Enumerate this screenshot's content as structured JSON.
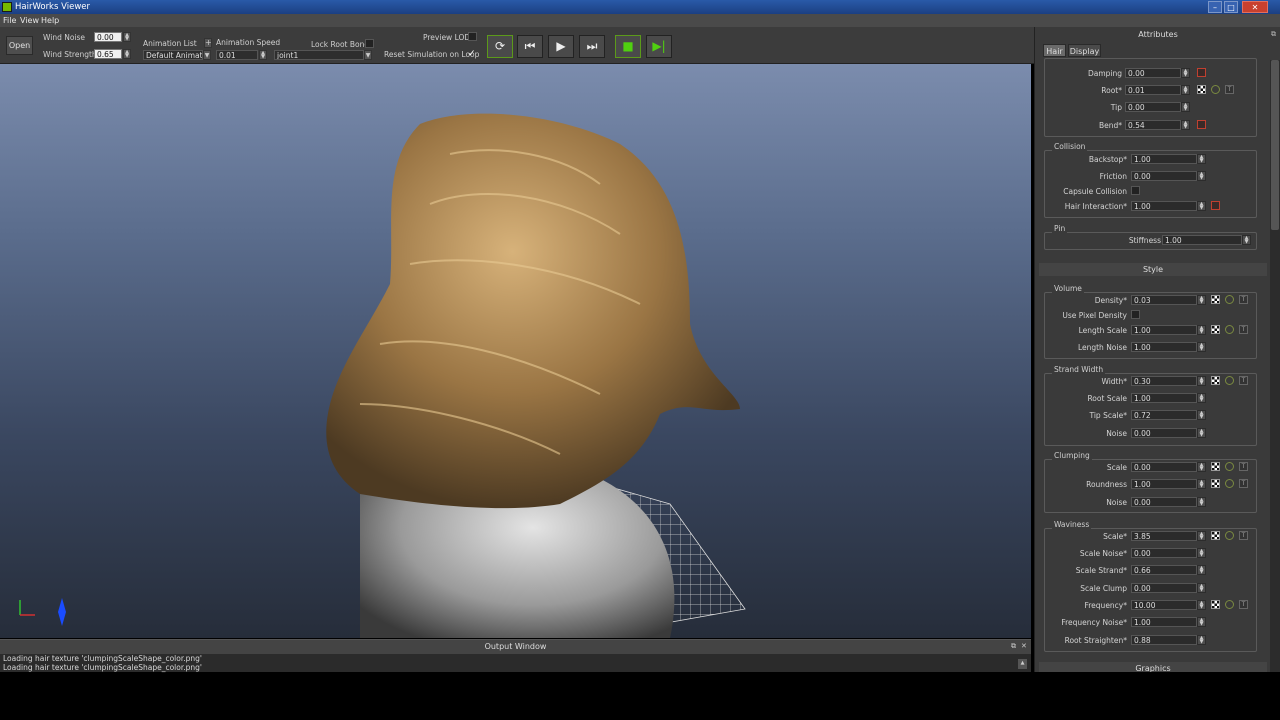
{
  "window": {
    "title": "HairWorks Viewer"
  },
  "menu": [
    "File",
    "View",
    "Help"
  ],
  "toolbar": {
    "open_label": "Open",
    "wind_noise_label": "Wind Noise",
    "wind_noise_value": "0.00",
    "wind_strength_label": "Wind Strength",
    "wind_strength_value": "0.65",
    "animation_list_label": "Animation List",
    "animation_list_value": "Default Animation",
    "animation_speed_label": "Animation Speed",
    "animation_speed_value": "0.01",
    "lock_root_bone_label": "Lock Root Bone",
    "lock_root_bone_value": "joint1",
    "preview_lod_label": "Preview LOD",
    "reset_sim_label": "Reset Simulation on Loop",
    "reset_sim_checked": "✓"
  },
  "output": {
    "title": "Output Window",
    "lines": [
      "Loading hair texture 'clumpingScaleShape_color.png'",
      "Loading hair texture 'clumpingScaleShape_color.png'"
    ]
  },
  "attributes": {
    "title": "Attributes",
    "tabs": [
      "Hair",
      "Display"
    ],
    "physics_rows": [
      {
        "label": "Damping",
        "value": "0.00"
      },
      {
        "label": "Root*",
        "value": "0.01"
      },
      {
        "label": "Tip",
        "value": "0.00"
      },
      {
        "label": "Bend*",
        "value": "0.54"
      }
    ],
    "collision": {
      "title": "Collision",
      "backstop_label": "Backstop*",
      "backstop_value": "1.00",
      "friction_label": "Friction",
      "friction_value": "0.00",
      "capsule_label": "Capsule Collision",
      "interaction_label": "Hair Interaction*",
      "interaction_value": "1.00"
    },
    "pin": {
      "title": "Pin",
      "stiffness_label": "Stiffness",
      "stiffness_value": "1.00"
    },
    "style_title": "Style",
    "volume": {
      "title": "Volume",
      "density_label": "Density*",
      "density_value": "0.03",
      "use_pixel_label": "Use Pixel Density",
      "length_scale_label": "Length Scale",
      "length_scale_value": "1.00",
      "length_noise_label": "Length Noise",
      "length_noise_value": "1.00"
    },
    "strand_width": {
      "title": "Strand Width",
      "width_label": "Width*",
      "width_value": "0.30",
      "root_scale_label": "Root Scale",
      "root_scale_value": "1.00",
      "tip_scale_label": "Tip Scale*",
      "tip_scale_value": "0.72",
      "noise_label": "Noise",
      "noise_value": "0.00"
    },
    "clumping": {
      "title": "Clumping",
      "scale_label": "Scale",
      "scale_value": "0.00",
      "roundness_label": "Roundness",
      "roundness_value": "1.00",
      "noise_label": "Noise",
      "noise_value": "0.00"
    },
    "waviness": {
      "title": "Waviness",
      "scale_label": "Scale*",
      "scale_value": "3.85",
      "scale_noise_label": "Scale Noise*",
      "scale_noise_value": "0.00",
      "scale_strand_label": "Scale Strand*",
      "scale_strand_value": "0.66",
      "scale_clump_label": "Scale Clump",
      "scale_clump_value": "0.00",
      "frequency_label": "Frequency*",
      "frequency_value": "10.00",
      "frequency_noise_label": "Frequency Noise*",
      "frequency_noise_value": "1.00",
      "root_straighten_label": "Root Straighten*",
      "root_straighten_value": "0.88"
    },
    "graphics_title": "Graphics"
  }
}
